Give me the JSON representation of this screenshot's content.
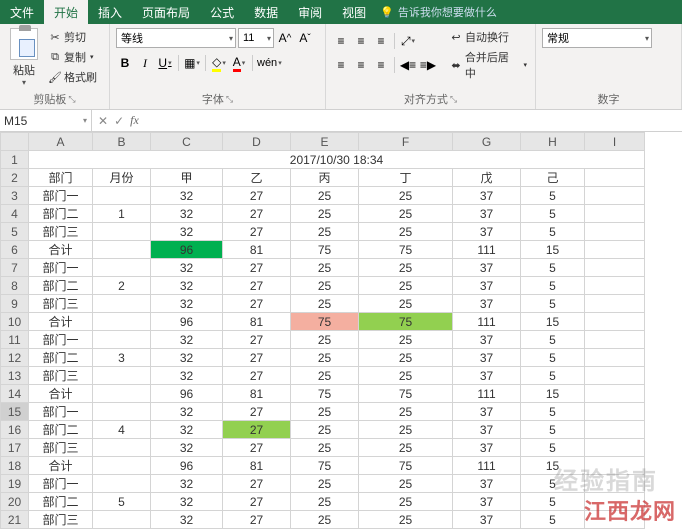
{
  "tabs": {
    "file": "文件",
    "home": "开始",
    "insert": "插入",
    "layout": "页面布局",
    "formulas": "公式",
    "data": "数据",
    "review": "审阅",
    "view": "视图",
    "tellme": "告诉我你想要做什么"
  },
  "ribbon": {
    "clipboard": {
      "paste": "粘贴",
      "cut": "剪切",
      "copy": "复制",
      "format_painter": "格式刷",
      "label": "剪贴板"
    },
    "font": {
      "name": "等线",
      "size": "11",
      "label": "字体"
    },
    "align": {
      "wrap": "自动换行",
      "merge": "合并后居中",
      "label": "对齐方式"
    },
    "number": {
      "format": "常规",
      "label": "数字"
    }
  },
  "namebox": "M15",
  "formula": "",
  "columns": [
    "A",
    "B",
    "C",
    "D",
    "E",
    "F",
    "G",
    "H",
    "I"
  ],
  "merged_header": {
    "text": "2017/10/30 18:34",
    "colspan": 9
  },
  "header_row": {
    "A": "部门",
    "B": "月份",
    "C": "甲",
    "D": "乙",
    "E": "丙",
    "F": "丁",
    "G": "戊",
    "H": "己"
  },
  "rows": [
    {
      "n": 3,
      "A": "部门一",
      "B": "",
      "C": 32,
      "D": 27,
      "E": 25,
      "F": 25,
      "G": 37,
      "H": 5
    },
    {
      "n": 4,
      "A": "部门二",
      "B": "1",
      "C": 32,
      "D": 27,
      "E": 25,
      "F": 25,
      "G": 37,
      "H": 5
    },
    {
      "n": 5,
      "A": "部门三",
      "B": "",
      "C": 32,
      "D": 27,
      "E": 25,
      "F": 25,
      "G": 37,
      "H": 5
    },
    {
      "n": 6,
      "A": "合计",
      "B": "",
      "C": 96,
      "D": 81,
      "E": 75,
      "F": 75,
      "G": 111,
      "H": 15,
      "hl": {
        "C": "hl-green-dark"
      }
    },
    {
      "n": 7,
      "A": "部门一",
      "B": "",
      "C": 32,
      "D": 27,
      "E": 25,
      "F": 25,
      "G": 37,
      "H": 5
    },
    {
      "n": 8,
      "A": "部门二",
      "B": "2",
      "C": 32,
      "D": 27,
      "E": 25,
      "F": 25,
      "G": 37,
      "H": 5
    },
    {
      "n": 9,
      "A": "部门三",
      "B": "",
      "C": 32,
      "D": 27,
      "E": 25,
      "F": 25,
      "G": 37,
      "H": 5
    },
    {
      "n": 10,
      "A": "合计",
      "B": "",
      "C": 96,
      "D": 81,
      "E": 75,
      "F": 75,
      "G": 111,
      "H": 15,
      "hl": {
        "E": "hl-red",
        "F": "hl-green"
      }
    },
    {
      "n": 11,
      "A": "部门一",
      "B": "",
      "C": 32,
      "D": 27,
      "E": 25,
      "F": 25,
      "G": 37,
      "H": 5
    },
    {
      "n": 12,
      "A": "部门二",
      "B": "3",
      "C": 32,
      "D": 27,
      "E": 25,
      "F": 25,
      "G": 37,
      "H": 5
    },
    {
      "n": 13,
      "A": "部门三",
      "B": "",
      "C": 32,
      "D": 27,
      "E": 25,
      "F": 25,
      "G": 37,
      "H": 5
    },
    {
      "n": 14,
      "A": "合计",
      "B": "",
      "C": 96,
      "D": 81,
      "E": 75,
      "F": 75,
      "G": 111,
      "H": 15
    },
    {
      "n": 15,
      "A": "部门一",
      "B": "",
      "C": 32,
      "D": 27,
      "E": 25,
      "F": 25,
      "G": 37,
      "H": 5,
      "selrow": true
    },
    {
      "n": 16,
      "A": "部门二",
      "B": "4",
      "C": 32,
      "D": 27,
      "E": 25,
      "F": 25,
      "G": 37,
      "H": 5,
      "hl": {
        "D": "hl-green"
      }
    },
    {
      "n": 17,
      "A": "部门三",
      "B": "",
      "C": 32,
      "D": 27,
      "E": 25,
      "F": 25,
      "G": 37,
      "H": 5
    },
    {
      "n": 18,
      "A": "合计",
      "B": "",
      "C": 96,
      "D": 81,
      "E": 75,
      "F": 75,
      "G": 111,
      "H": 15
    },
    {
      "n": 19,
      "A": "部门一",
      "B": "",
      "C": 32,
      "D": 27,
      "E": 25,
      "F": 25,
      "G": 37,
      "H": 5
    },
    {
      "n": 20,
      "A": "部门二",
      "B": "5",
      "C": 32,
      "D": 27,
      "E": 25,
      "F": 25,
      "G": 37,
      "H": 5
    },
    {
      "n": 21,
      "A": "部门三",
      "B": "",
      "C": 32,
      "D": 27,
      "E": 25,
      "F": 25,
      "G": 37,
      "H": 5
    }
  ],
  "selected_cell": "M15",
  "watermarks": {
    "w1": "经验指南",
    "w2": "江西龙网"
  }
}
